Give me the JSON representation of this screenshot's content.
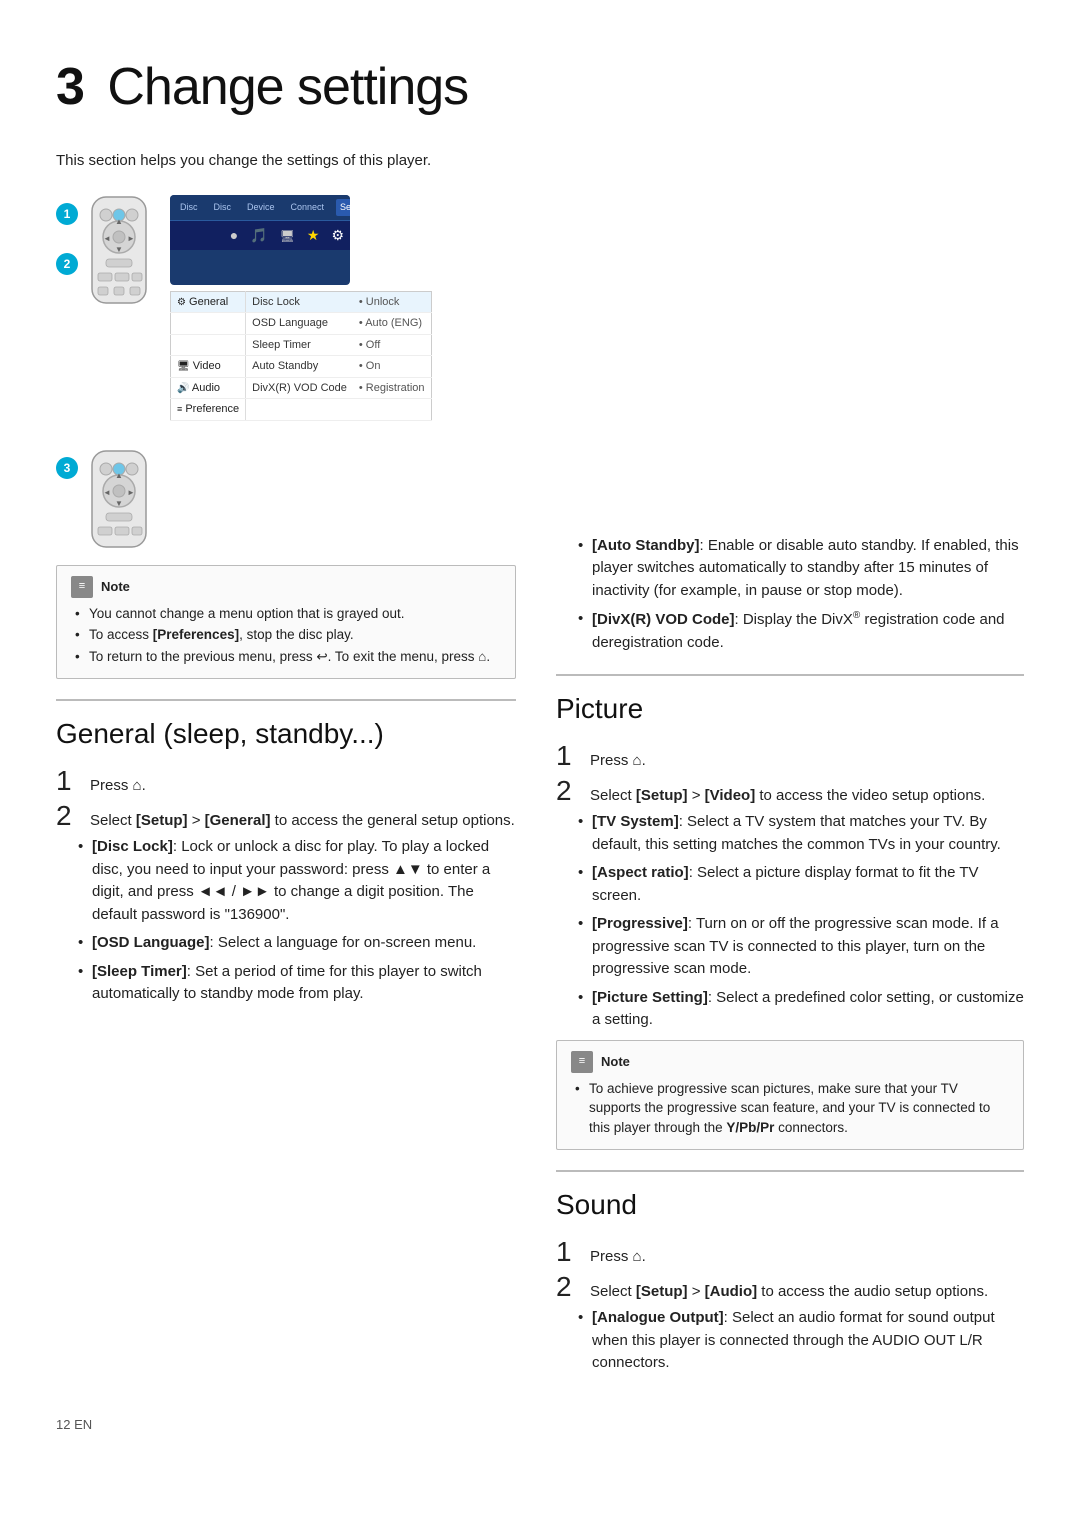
{
  "page": {
    "footer": "12    EN"
  },
  "chapter": {
    "number": "3",
    "title": "Change settings",
    "intro": "This section helps you change the settings of this player."
  },
  "note1": {
    "header": "Note",
    "items": [
      "You cannot change a menu option that is grayed out.",
      "To access [Preferences], stop the disc play.",
      "To return to the previous menu, press ↩. To exit the menu, press ⌂."
    ]
  },
  "general_section": {
    "title": "General (sleep, standby...)",
    "step1_label": "Press",
    "step2_label": "Select",
    "step2_text": "[Setup] > [General] to access the general setup options.",
    "bullets": [
      {
        "label": "[Disc Lock]",
        "text": ": Lock or unlock a disc for play. To play a locked disc, you need to input your password: press ▲▼ to enter a digit, and press ◄◄/►► to change a digit position. The default password is \"136900\"."
      },
      {
        "label": "[OSD Language]",
        "text": ": Select a language for on-screen menu."
      },
      {
        "label": "[Sleep Timer]",
        "text": ": Set a period of time for this player to switch automatically to standby mode from play."
      },
      {
        "label": "[Auto Standby]",
        "text": ": Enable or disable auto standby. If enabled, this player switches automatically to standby after 15 minutes of inactivity (for example, in pause or stop mode)."
      },
      {
        "label": "[DivX(R) VOD Code]",
        "text": ": Display the DivX® registration code and deregistration code."
      }
    ]
  },
  "picture_section": {
    "title": "Picture",
    "step1_label": "Press",
    "step2_label": "Select",
    "step2_text": "[Setup] > [Video] to access the video setup options.",
    "bullets": [
      {
        "label": "[TV System]",
        "text": ": Select a TV system that matches your TV. By default, this setting matches the common TVs in your country."
      },
      {
        "label": "[Aspect ratio]",
        "text": ": Select a picture display format to fit the TV screen."
      },
      {
        "label": "[Progressive]",
        "text": ": Turn on or off the progressive scan mode. If a progressive scan TV is connected to this player, turn on the progressive scan mode."
      },
      {
        "label": "[Picture Setting]",
        "text": ": Select a predefined color setting, or customize a setting."
      }
    ]
  },
  "note2": {
    "header": "Note",
    "items": [
      "To achieve progressive scan pictures, make sure that your TV supports the progressive scan feature, and your TV is connected to this player through the Y/Pb/Pr connectors."
    ]
  },
  "sound_section": {
    "title": "Sound",
    "step1_label": "Press",
    "step2_label": "Select",
    "step2_text": "[Setup] > [Audio] to access the audio setup options.",
    "bullets": [
      {
        "label": "[Analogue Output]",
        "text": ": Select an audio format for sound output when this player is connected through the AUDIO OUT L/R connectors."
      }
    ]
  },
  "settings_menu": {
    "tabs": [
      "Disc",
      "Disc",
      "Device",
      "Connect",
      "Setup"
    ],
    "rows": [
      {
        "cat": "General",
        "item": "Disc Lock",
        "val": "• Unlock"
      },
      {
        "cat": "",
        "item": "OSD Language",
        "val": "• Auto (ENG)"
      },
      {
        "cat": "",
        "item": "Sleep Timer",
        "val": "• Off"
      },
      {
        "cat": "Video",
        "item": "Auto Standby",
        "val": "• On"
      },
      {
        "cat": "Audio",
        "item": "DivX(R) VOD Code",
        "val": "• Registration"
      },
      {
        "cat": "Preference",
        "item": "",
        "val": ""
      }
    ]
  }
}
